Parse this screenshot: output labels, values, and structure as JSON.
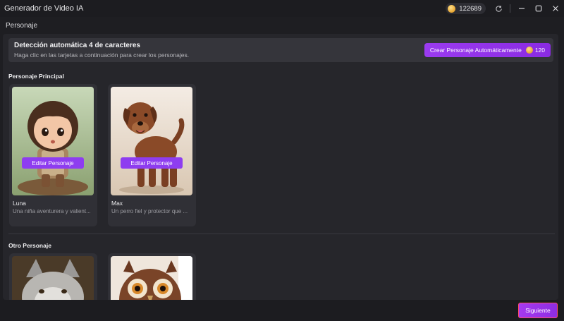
{
  "window": {
    "title": "Generador de Video IA",
    "coin_count": "122689"
  },
  "section": {
    "title": "Personaje"
  },
  "banner": {
    "title": "Detección automática 4 de caracteres",
    "subtitle": "Haga clic en las tarjetas a continuación para crear los personajes.",
    "auto_button_label": "Crear Personaje Automáticamente",
    "auto_button_cost": "120"
  },
  "main_group": {
    "label": "Personaje Principal",
    "characters": [
      {
        "name": "Luna",
        "description": "Una niña aventurera y valient...",
        "edit_label": "Editar Personaje"
      },
      {
        "name": "Max",
        "description": "Un perro fiel y protector que ...",
        "edit_label": "Editar Personaje"
      }
    ]
  },
  "other_group": {
    "label": "Otro Personaje"
  },
  "footer": {
    "next_label": "Siguiente"
  },
  "colors": {
    "accent": "#8e3df0",
    "next_border": "#ff4d6d",
    "background": "#1e1e22"
  }
}
